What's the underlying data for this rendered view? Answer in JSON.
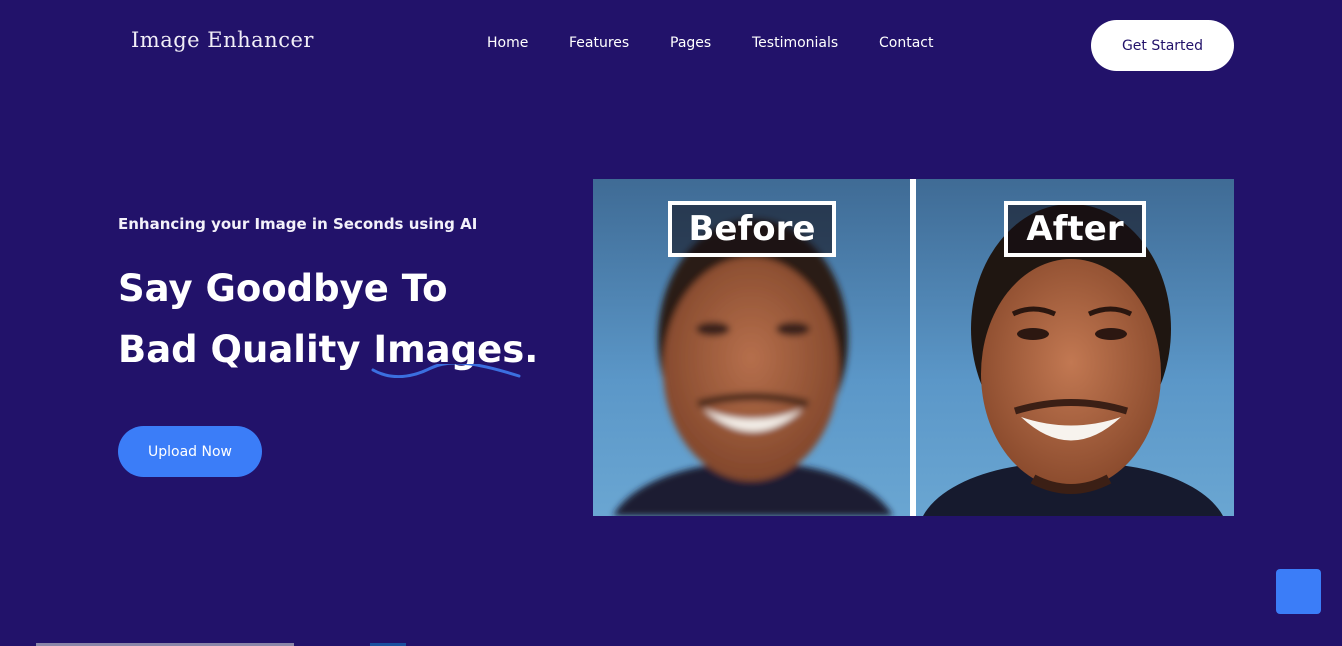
{
  "header": {
    "logo": "Image Enhancer",
    "nav": [
      {
        "label": "Home"
      },
      {
        "label": "Features"
      },
      {
        "label": "Pages"
      },
      {
        "label": "Testimonials"
      },
      {
        "label": "Contact"
      }
    ],
    "cta_label": "Get Started"
  },
  "hero": {
    "eyebrow": "Enhancing your Image in Seconds using AI",
    "headline_line1": "Say Goodbye To",
    "headline_line2_prefix": "Bad Quality ",
    "headline_line2_highlight": "Images",
    "headline_line2_suffix": ".",
    "upload_label": "Upload Now"
  },
  "comparison": {
    "before_label": "Before",
    "after_label": "After"
  },
  "colors": {
    "background": "#22126a",
    "accent": "#3b7df8",
    "white": "#ffffff"
  }
}
